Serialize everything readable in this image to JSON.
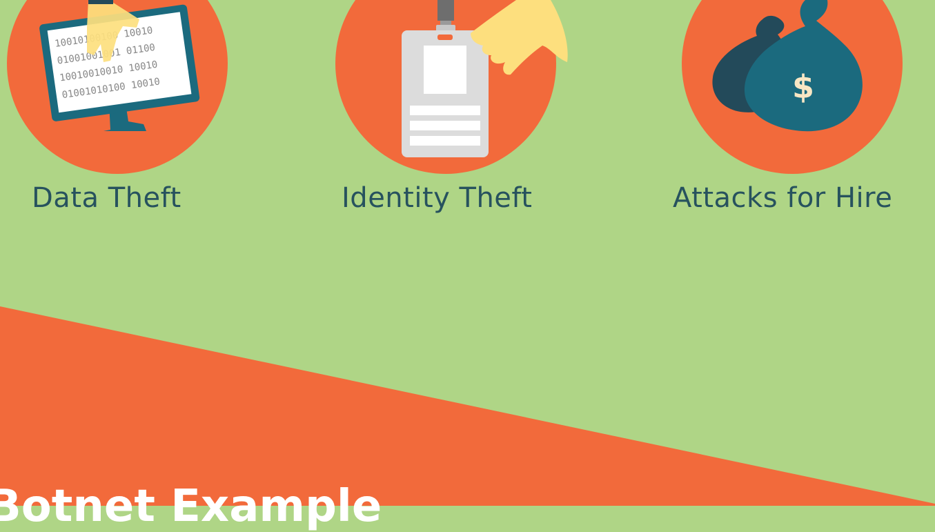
{
  "threats": [
    {
      "id": "data-theft",
      "label": "Data Theft",
      "icon": "monitor-binary-hand-icon",
      "binary_lines": [
        "10010100100 10010",
        "01001001001 01100",
        "10010010010 10010",
        "01001010100 10010"
      ]
    },
    {
      "id": "identity-theft",
      "label": "Identity Theft",
      "icon": "id-badge-hand-icon"
    },
    {
      "id": "attacks-for-hire",
      "label": "Attacks for Hire",
      "icon": "money-bag-icon",
      "currency_symbol": "$"
    }
  ],
  "section": {
    "title": "Botnet Example"
  },
  "colors": {
    "background": "#afd586",
    "accent_orange": "#f26a3b",
    "text_dark": "#27525e",
    "teal": "#1b6a7e",
    "dark_teal": "#234a5a",
    "skin": "#fddf7e",
    "badge_gray": "#dcdcdc"
  }
}
